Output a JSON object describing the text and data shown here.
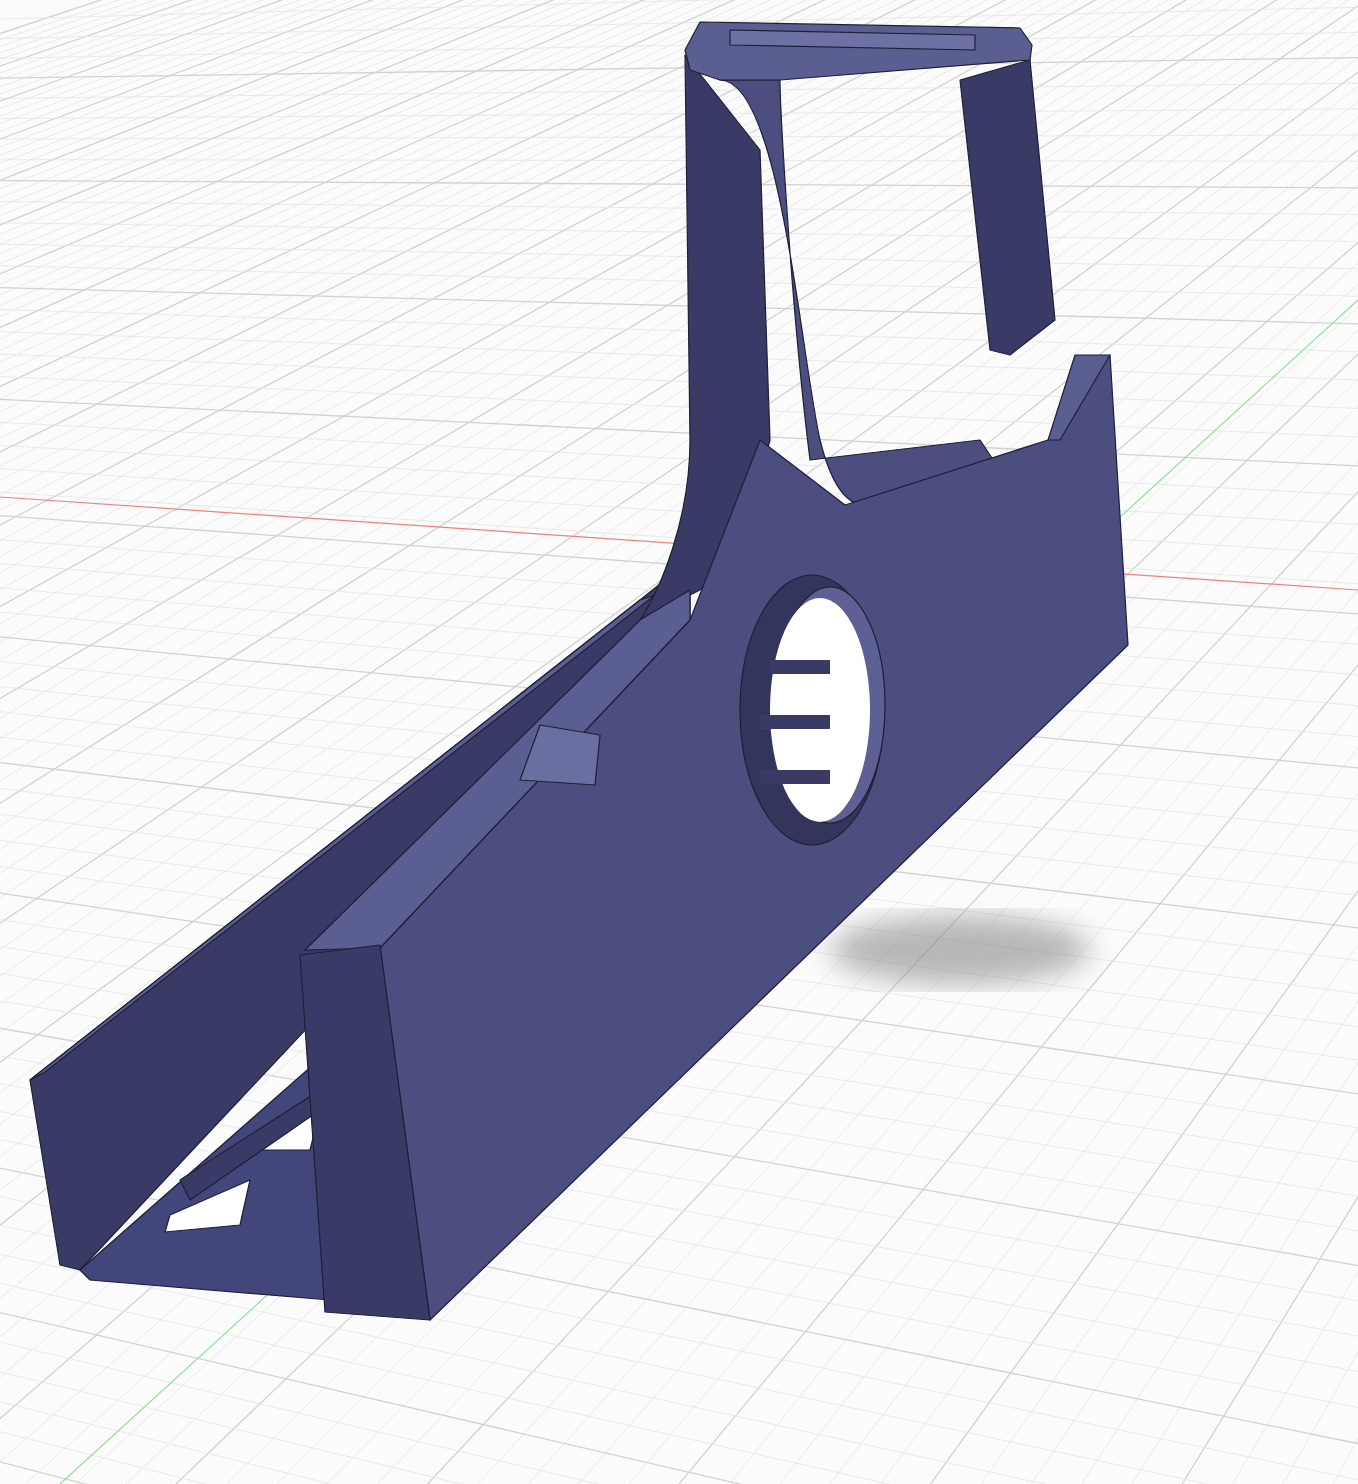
{
  "viewport": {
    "grid": true,
    "axes": true,
    "shadow": true
  }
}
